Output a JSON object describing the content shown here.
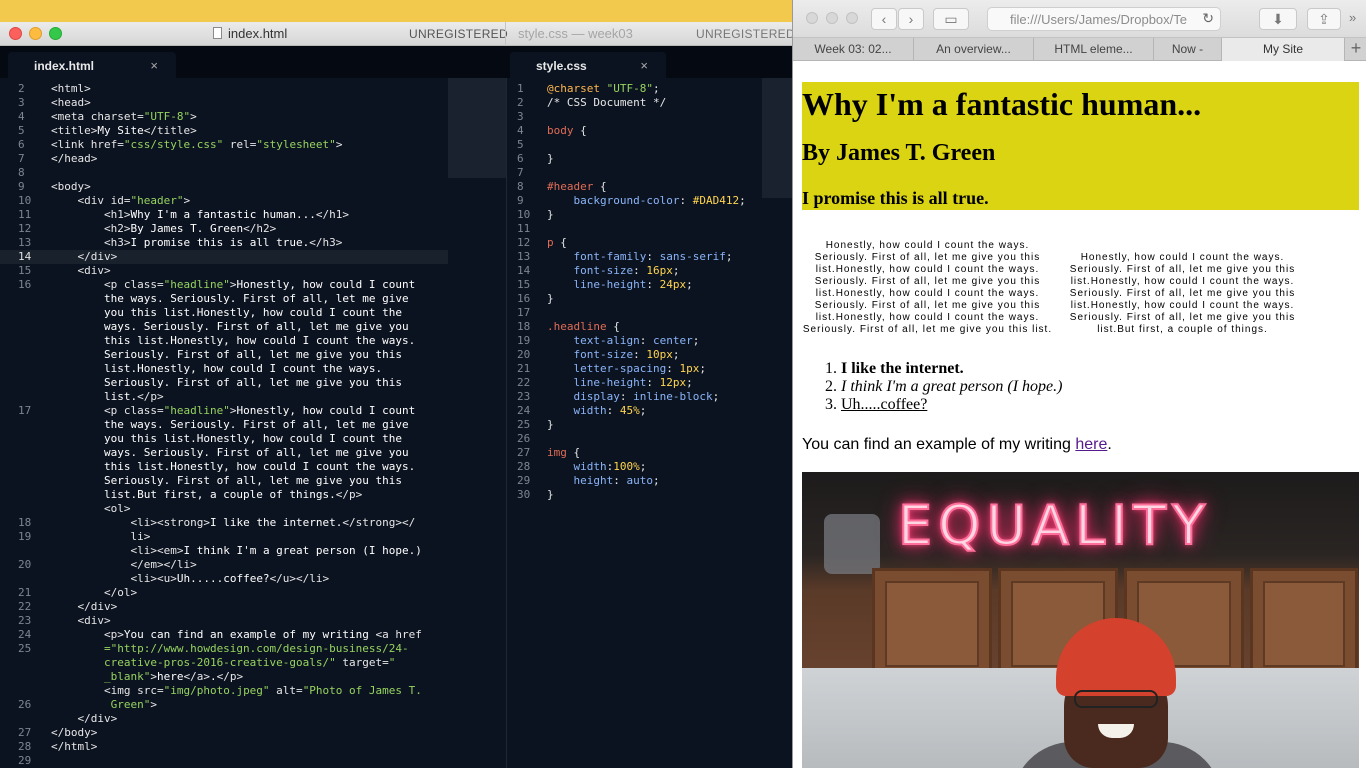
{
  "editor": {
    "window_title_left": "index.html",
    "window_title_right": "style.css — week03",
    "unregistered_left": "UNREGISTERED",
    "unregistered_right": "UNREGISTERED",
    "tabs": [
      {
        "label": "index.html",
        "close": "×"
      },
      {
        "label": "style.css",
        "close": "×"
      }
    ],
    "html_line_numbers": [
      "2",
      "3",
      "4",
      "5",
      "6",
      "7",
      "8",
      "9",
      "10",
      "11",
      "12",
      "13",
      "14",
      "15",
      "16",
      "",
      "",
      "",
      "",
      "",
      "",
      "",
      "",
      "17",
      "",
      "",
      "",
      "",
      "",
      "",
      "",
      "18",
      "19",
      "",
      "20",
      "",
      "21",
      "22",
      "23",
      "24",
      "25",
      "",
      "",
      "",
      "26",
      "",
      "27",
      "28",
      "29",
      "30"
    ],
    "css_line_numbers": [
      "1",
      "2",
      "3",
      "4",
      "5",
      "6",
      "7",
      "8",
      "9",
      "10",
      "11",
      "12",
      "13",
      "14",
      "15",
      "16",
      "17",
      "18",
      "19",
      "20",
      "21",
      "22",
      "23",
      "24",
      "25",
      "26",
      "27",
      "28",
      "29",
      "30"
    ],
    "current_line": "14"
  },
  "browser": {
    "url": "file:///Users/James/Dropbox/Te",
    "tabs": [
      "Week 03: 02...",
      "An overview...",
      "HTML eleme...",
      "Now -",
      "My Site"
    ],
    "active_tab": "My Site",
    "add_tab": "+",
    "page": {
      "h1": "Why I'm a fantastic human...",
      "h2": "By James T. Green",
      "h3": "I promise this is all true.",
      "headline1": "Honestly, how could I count the ways. Seriously. First of all, let me give you this list.Honestly, how could I count the ways. Seriously. First of all, let me give you this list.Honestly, how could I count the ways. Seriously. First of all, let me give you this list.Honestly, how could I count the ways. Seriously. First of all, let me give you this list.",
      "headline2": "Honestly, how could I count the ways. Seriously. First of all, let me give you this list.Honestly, how could I count the ways. Seriously. First of all, let me give you this list.Honestly, how could I count the ways. Seriously. First of all, let me give you this list.But first, a couple of things.",
      "list": [
        "I like the internet.",
        "I think I'm a great person (I hope.)",
        "Uh.....coffee?"
      ],
      "writing_text": "You can find an example of my writing ",
      "writing_link": "here",
      "writing_end": ".",
      "photo_sign": "EQUALITY"
    }
  },
  "colors": {
    "header_bg": "#DAD412",
    "editor_bg": "#0c1320",
    "desktop": "#f2c94c"
  }
}
